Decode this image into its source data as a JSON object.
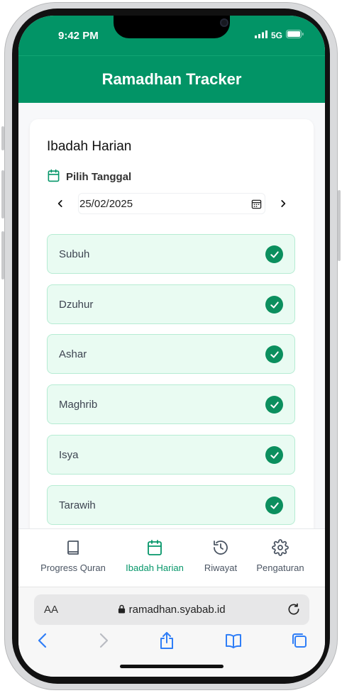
{
  "status_bar": {
    "time": "9:42 PM",
    "network": "5G"
  },
  "header": {
    "title": "Ramadhan Tracker"
  },
  "card": {
    "title": "Ibadah Harian",
    "date_label": "Pilih Tanggal",
    "date_value": "25/02/2025",
    "prayers": [
      {
        "label": "Subuh",
        "checked": true
      },
      {
        "label": "Dzuhur",
        "checked": true
      },
      {
        "label": "Ashar",
        "checked": true
      },
      {
        "label": "Maghrib",
        "checked": true
      },
      {
        "label": "Isya",
        "checked": true
      },
      {
        "label": "Tarawih",
        "checked": true
      }
    ]
  },
  "tabs": [
    {
      "label": "Progress Quran",
      "icon": "book-icon"
    },
    {
      "label": "Ibadah Harian",
      "icon": "calendar-icon",
      "active": true
    },
    {
      "label": "Riwayat",
      "icon": "history-icon"
    },
    {
      "label": "Pengaturan",
      "icon": "gear-icon"
    }
  ],
  "browser": {
    "aa_label": "AA",
    "url": "ramadhan.syabab.id"
  },
  "colors": {
    "primary": "#029466",
    "check": "#0b8f5e",
    "item_bg": "#e9fbf2",
    "item_border": "#b6ecd3",
    "active_tab": "#059669"
  }
}
